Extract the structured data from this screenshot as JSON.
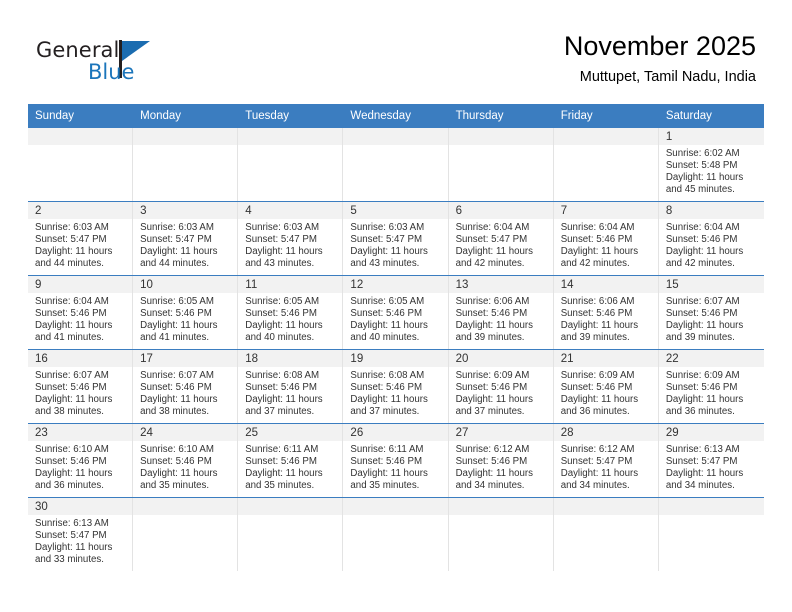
{
  "brand": {
    "name_part1": "General",
    "name_part2": "Blue",
    "primary_color": "#3b7dc0",
    "accent_color": "#1b75bb"
  },
  "header": {
    "title": "November 2025",
    "subtitle": "Muttupet, Tamil Nadu, India"
  },
  "weekday_headers": [
    "Sunday",
    "Monday",
    "Tuesday",
    "Wednesday",
    "Thursday",
    "Friday",
    "Saturday"
  ],
  "weeks": [
    [
      {
        "day": "",
        "sunrise": "",
        "sunset": "",
        "daylight1": "",
        "daylight2": "",
        "blank": true
      },
      {
        "day": "",
        "sunrise": "",
        "sunset": "",
        "daylight1": "",
        "daylight2": "",
        "blank": true
      },
      {
        "day": "",
        "sunrise": "",
        "sunset": "",
        "daylight1": "",
        "daylight2": "",
        "blank": true
      },
      {
        "day": "",
        "sunrise": "",
        "sunset": "",
        "daylight1": "",
        "daylight2": "",
        "blank": true
      },
      {
        "day": "",
        "sunrise": "",
        "sunset": "",
        "daylight1": "",
        "daylight2": "",
        "blank": true
      },
      {
        "day": "",
        "sunrise": "",
        "sunset": "",
        "daylight1": "",
        "daylight2": "",
        "blank": true
      },
      {
        "day": "1",
        "sunrise": "Sunrise: 6:02 AM",
        "sunset": "Sunset: 5:48 PM",
        "daylight1": "Daylight: 11 hours",
        "daylight2": "and 45 minutes."
      }
    ],
    [
      {
        "day": "2",
        "sunrise": "Sunrise: 6:03 AM",
        "sunset": "Sunset: 5:47 PM",
        "daylight1": "Daylight: 11 hours",
        "daylight2": "and 44 minutes."
      },
      {
        "day": "3",
        "sunrise": "Sunrise: 6:03 AM",
        "sunset": "Sunset: 5:47 PM",
        "daylight1": "Daylight: 11 hours",
        "daylight2": "and 44 minutes."
      },
      {
        "day": "4",
        "sunrise": "Sunrise: 6:03 AM",
        "sunset": "Sunset: 5:47 PM",
        "daylight1": "Daylight: 11 hours",
        "daylight2": "and 43 minutes."
      },
      {
        "day": "5",
        "sunrise": "Sunrise: 6:03 AM",
        "sunset": "Sunset: 5:47 PM",
        "daylight1": "Daylight: 11 hours",
        "daylight2": "and 43 minutes."
      },
      {
        "day": "6",
        "sunrise": "Sunrise: 6:04 AM",
        "sunset": "Sunset: 5:47 PM",
        "daylight1": "Daylight: 11 hours",
        "daylight2": "and 42 minutes."
      },
      {
        "day": "7",
        "sunrise": "Sunrise: 6:04 AM",
        "sunset": "Sunset: 5:46 PM",
        "daylight1": "Daylight: 11 hours",
        "daylight2": "and 42 minutes."
      },
      {
        "day": "8",
        "sunrise": "Sunrise: 6:04 AM",
        "sunset": "Sunset: 5:46 PM",
        "daylight1": "Daylight: 11 hours",
        "daylight2": "and 42 minutes."
      }
    ],
    [
      {
        "day": "9",
        "sunrise": "Sunrise: 6:04 AM",
        "sunset": "Sunset: 5:46 PM",
        "daylight1": "Daylight: 11 hours",
        "daylight2": "and 41 minutes."
      },
      {
        "day": "10",
        "sunrise": "Sunrise: 6:05 AM",
        "sunset": "Sunset: 5:46 PM",
        "daylight1": "Daylight: 11 hours",
        "daylight2": "and 41 minutes."
      },
      {
        "day": "11",
        "sunrise": "Sunrise: 6:05 AM",
        "sunset": "Sunset: 5:46 PM",
        "daylight1": "Daylight: 11 hours",
        "daylight2": "and 40 minutes."
      },
      {
        "day": "12",
        "sunrise": "Sunrise: 6:05 AM",
        "sunset": "Sunset: 5:46 PM",
        "daylight1": "Daylight: 11 hours",
        "daylight2": "and 40 minutes."
      },
      {
        "day": "13",
        "sunrise": "Sunrise: 6:06 AM",
        "sunset": "Sunset: 5:46 PM",
        "daylight1": "Daylight: 11 hours",
        "daylight2": "and 39 minutes."
      },
      {
        "day": "14",
        "sunrise": "Sunrise: 6:06 AM",
        "sunset": "Sunset: 5:46 PM",
        "daylight1": "Daylight: 11 hours",
        "daylight2": "and 39 minutes."
      },
      {
        "day": "15",
        "sunrise": "Sunrise: 6:07 AM",
        "sunset": "Sunset: 5:46 PM",
        "daylight1": "Daylight: 11 hours",
        "daylight2": "and 39 minutes."
      }
    ],
    [
      {
        "day": "16",
        "sunrise": "Sunrise: 6:07 AM",
        "sunset": "Sunset: 5:46 PM",
        "daylight1": "Daylight: 11 hours",
        "daylight2": "and 38 minutes."
      },
      {
        "day": "17",
        "sunrise": "Sunrise: 6:07 AM",
        "sunset": "Sunset: 5:46 PM",
        "daylight1": "Daylight: 11 hours",
        "daylight2": "and 38 minutes."
      },
      {
        "day": "18",
        "sunrise": "Sunrise: 6:08 AM",
        "sunset": "Sunset: 5:46 PM",
        "daylight1": "Daylight: 11 hours",
        "daylight2": "and 37 minutes."
      },
      {
        "day": "19",
        "sunrise": "Sunrise: 6:08 AM",
        "sunset": "Sunset: 5:46 PM",
        "daylight1": "Daylight: 11 hours",
        "daylight2": "and 37 minutes."
      },
      {
        "day": "20",
        "sunrise": "Sunrise: 6:09 AM",
        "sunset": "Sunset: 5:46 PM",
        "daylight1": "Daylight: 11 hours",
        "daylight2": "and 37 minutes."
      },
      {
        "day": "21",
        "sunrise": "Sunrise: 6:09 AM",
        "sunset": "Sunset: 5:46 PM",
        "daylight1": "Daylight: 11 hours",
        "daylight2": "and 36 minutes."
      },
      {
        "day": "22",
        "sunrise": "Sunrise: 6:09 AM",
        "sunset": "Sunset: 5:46 PM",
        "daylight1": "Daylight: 11 hours",
        "daylight2": "and 36 minutes."
      }
    ],
    [
      {
        "day": "23",
        "sunrise": "Sunrise: 6:10 AM",
        "sunset": "Sunset: 5:46 PM",
        "daylight1": "Daylight: 11 hours",
        "daylight2": "and 36 minutes."
      },
      {
        "day": "24",
        "sunrise": "Sunrise: 6:10 AM",
        "sunset": "Sunset: 5:46 PM",
        "daylight1": "Daylight: 11 hours",
        "daylight2": "and 35 minutes."
      },
      {
        "day": "25",
        "sunrise": "Sunrise: 6:11 AM",
        "sunset": "Sunset: 5:46 PM",
        "daylight1": "Daylight: 11 hours",
        "daylight2": "and 35 minutes."
      },
      {
        "day": "26",
        "sunrise": "Sunrise: 6:11 AM",
        "sunset": "Sunset: 5:46 PM",
        "daylight1": "Daylight: 11 hours",
        "daylight2": "and 35 minutes."
      },
      {
        "day": "27",
        "sunrise": "Sunrise: 6:12 AM",
        "sunset": "Sunset: 5:46 PM",
        "daylight1": "Daylight: 11 hours",
        "daylight2": "and 34 minutes."
      },
      {
        "day": "28",
        "sunrise": "Sunrise: 6:12 AM",
        "sunset": "Sunset: 5:47 PM",
        "daylight1": "Daylight: 11 hours",
        "daylight2": "and 34 minutes."
      },
      {
        "day": "29",
        "sunrise": "Sunrise: 6:13 AM",
        "sunset": "Sunset: 5:47 PM",
        "daylight1": "Daylight: 11 hours",
        "daylight2": "and 34 minutes."
      }
    ],
    [
      {
        "day": "30",
        "sunrise": "Sunrise: 6:13 AM",
        "sunset": "Sunset: 5:47 PM",
        "daylight1": "Daylight: 11 hours",
        "daylight2": "and 33 minutes."
      },
      {
        "day": "",
        "sunrise": "",
        "sunset": "",
        "daylight1": "",
        "daylight2": "",
        "blank": true
      },
      {
        "day": "",
        "sunrise": "",
        "sunset": "",
        "daylight1": "",
        "daylight2": "",
        "blank": true
      },
      {
        "day": "",
        "sunrise": "",
        "sunset": "",
        "daylight1": "",
        "daylight2": "",
        "blank": true
      },
      {
        "day": "",
        "sunrise": "",
        "sunset": "",
        "daylight1": "",
        "daylight2": "",
        "blank": true
      },
      {
        "day": "",
        "sunrise": "",
        "sunset": "",
        "daylight1": "",
        "daylight2": "",
        "blank": true
      },
      {
        "day": "",
        "sunrise": "",
        "sunset": "",
        "daylight1": "",
        "daylight2": "",
        "blank": true
      }
    ]
  ]
}
